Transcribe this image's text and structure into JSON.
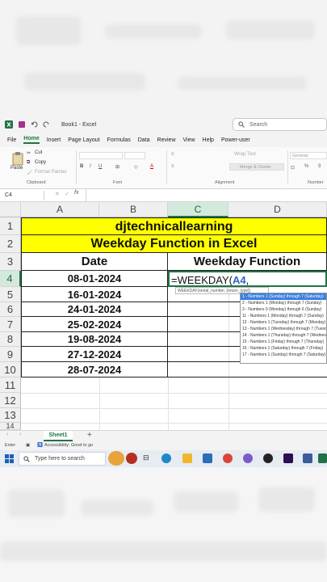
{
  "titlebar": {
    "doc_title": "Book1 - Excel",
    "search_placeholder": "Search"
  },
  "menu": [
    "File",
    "Home",
    "Insert",
    "Page Layout",
    "Formulas",
    "Data",
    "Review",
    "View",
    "Help",
    "Power-user"
  ],
  "ribbon": {
    "cut": "Cut",
    "copy": "Copy",
    "paste": "Paste",
    "format_painter": "Format Painter",
    "wrap_text": "Wrap Text",
    "merge_center": "Merge & Center",
    "number_format": "General",
    "groups": {
      "clipboard": "Clipboard",
      "font": "Font",
      "alignment": "Alignment",
      "number": "Number"
    }
  },
  "formula_bar": {
    "name_box": "C4",
    "fx": "fx"
  },
  "grid": {
    "columns": [
      "A",
      "B",
      "C",
      "D"
    ],
    "rows": [
      "1",
      "2",
      "3",
      "4",
      "5",
      "6",
      "7",
      "8",
      "9",
      "10",
      "11",
      "12",
      "13",
      "14"
    ],
    "title1": "djtechnicallearning",
    "title2": "Weekday Function in Excel",
    "header_date": "Date",
    "header_weekday": "Weekday Function",
    "dates": [
      "08-01-2024",
      "16-01-2024",
      "24-01-2024",
      "25-02-2024",
      "19-08-2024",
      "27-12-2024",
      "28-07-2024"
    ],
    "formula_prefix": "=WEEKDAY(",
    "formula_ref": "A4",
    "formula_suffix": ","
  },
  "tooltip_hint": "WEEKDAY(serial_number, [return_type])",
  "return_type_options": [
    "1 - Numbers 1 (Sunday) through 7 (Saturday)",
    "2 - Numbers 1 (Monday) through 7 (Sunday)",
    "3 - Numbers 0 (Monday) through 6 (Sunday)",
    "11 - Numbers 1 (Monday) through 7 (Sunday)",
    "12 - Numbers 1 (Tuesday) through 7 (Monday)",
    "13 - Numbers 1 (Wednesday) through 7 (Tuesday)",
    "14 - Numbers 1 (Thursday) through 7 (Wednesday)",
    "15 - Numbers 1 (Friday) through 7 (Thursday)",
    "16 - Numbers 1 (Saturday) through 7 (Friday)",
    "17 - Numbers 1 (Sunday) through 7 (Saturday)"
  ],
  "sheet_tab": "Sheet1",
  "status": {
    "mode": "Enter",
    "accessibility": "Accessibility: Good to go"
  },
  "taskbar": {
    "search_placeholder": "Type here to search"
  },
  "colors": {
    "excel_green": "#217346",
    "title_fill": "#ffff00",
    "formula_ref": "#2f63c8",
    "dropdown_highlight": "#3a7fe0"
  }
}
